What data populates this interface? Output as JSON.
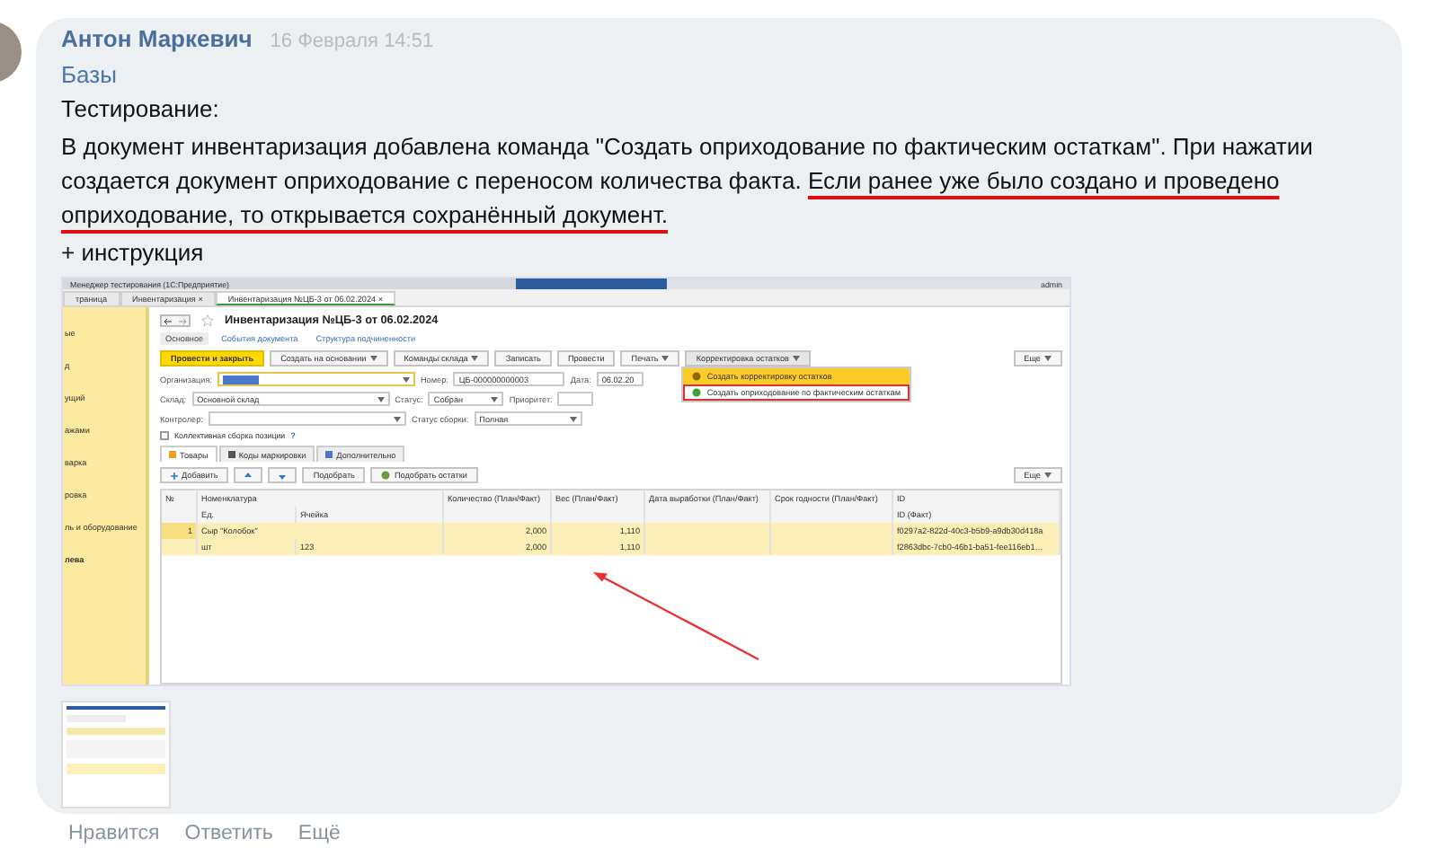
{
  "message": {
    "author": "Антон Маркевич",
    "time": "16 Февраля 14:51",
    "link": "Базы",
    "heading": "Тестирование:",
    "body": "В документ инвентаризация добавлена команда \"Создать оприходование по фактическим остаткам\". При нажатии создается документ оприходование с переносом количества факта. ",
    "highlight": "Если ранее уже было создано и проведено оприходование, то открывается сохранённый документ.",
    "extra": "+ инструкция"
  },
  "attachment": {
    "window_title": "Менеджер тестирования (1С:Предприятие)",
    "user": "admin",
    "tabs": [
      {
        "label": "траница",
        "selected": false
      },
      {
        "label": "Инвентаризация",
        "close": "×",
        "selected": false
      },
      {
        "label": "Инвентаризация №ЦБ-3 от 06.02.2024",
        "close": "×",
        "selected": true
      }
    ],
    "sidebar": [
      {
        "label": "ые",
        "selected": false
      },
      {
        "label": "д",
        "selected": false
      },
      {
        "label": "ущий",
        "selected": false
      },
      {
        "label": "ажами",
        "selected": false
      },
      {
        "label": "варка",
        "selected": false
      },
      {
        "label": "ровка",
        "selected": false
      },
      {
        "label": "ль и оборудование",
        "selected": false
      },
      {
        "label": "лева",
        "selected": true
      }
    ],
    "document_title": "Инвентаризация №ЦБ-3 от 06.02.2024",
    "links": [
      {
        "label": "Основное",
        "selected": true
      },
      {
        "label": "События документа",
        "selected": false
      },
      {
        "label": "Структура подчиненности",
        "selected": false
      }
    ],
    "toolbar": [
      {
        "label": "Провести и закрыть",
        "kind": "primary"
      },
      {
        "label": "Создать на основании",
        "kind": "menu"
      },
      {
        "label": "Команды склада",
        "kind": "menu"
      },
      {
        "label": "Записать",
        "kind": "plain"
      },
      {
        "label": "Провести",
        "kind": "plain"
      },
      {
        "label": "Печать",
        "kind": "menu"
      },
      {
        "label": "Корректировка остатков",
        "kind": "dropdown"
      },
      {
        "label": "Еще",
        "kind": "more"
      }
    ],
    "dropdown": [
      {
        "label": "Создать корректировку остатков",
        "selected": true,
        "outlined": false
      },
      {
        "label": "Создать оприходование по фактическим остаткам",
        "selected": false,
        "outlined": true
      }
    ],
    "form": [
      [
        {
          "label": "Организация:",
          "kind": "select",
          "focused": true
        },
        {
          "label": "Номер:",
          "value": "ЦБ-000000000003",
          "kind": "text",
          "focused": false
        },
        {
          "label": "Дата:",
          "value": "06.02.20",
          "kind": "text",
          "focused": false
        }
      ],
      [
        {
          "label": "Склад:",
          "value": "Основной склад",
          "kind": "select",
          "focused": false
        },
        {
          "label": "Статус:",
          "value": "Собран",
          "kind": "select",
          "focused": false
        },
        {
          "label": "Приоритет:",
          "kind": "text",
          "focused": false
        }
      ],
      [
        {
          "label": "Контролер:",
          "kind": "select",
          "focused": false
        },
        {
          "label": "Статус сборки:",
          "value": "Полная",
          "kind": "select",
          "focused": false
        }
      ]
    ],
    "checkbox": {
      "label": "Коллективная сборка позиции",
      "help": "?",
      "checked": false
    },
    "sections": [
      {
        "label": "Товары",
        "selected": true
      },
      {
        "label": "Коды маркировки",
        "selected": false
      },
      {
        "label": "Дополнительно",
        "selected": false
      }
    ],
    "table_toolbar": [
      {
        "label": "Добавить",
        "kind": "add"
      },
      {
        "kind": "up"
      },
      {
        "kind": "down"
      },
      {
        "label": "Подобрать",
        "kind": "plain"
      },
      {
        "label": "Подобрать остатки",
        "kind": "pick"
      },
      {
        "label": "Еще",
        "kind": "more"
      }
    ],
    "rows": [
      {
        "kind": "header",
        "no": "№",
        "item": "Номенклатура",
        "qty": "Количество (План/Факт)",
        "weight": "Вес (План/Факт)",
        "made": "Дата выработки (План/Факт)",
        "expires": "Срок годности (План/Факт)",
        "id": "ID"
      },
      {
        "kind": "header",
        "unit": "Ед.",
        "bin": "Ячейка",
        "id": "ID (Факт)"
      },
      {
        "kind": "data",
        "no": "1",
        "item": "Сыр \"Колобок\"",
        "qty": "2,000",
        "weight": "1,110",
        "id": "f0297a2-822d-40c3-b5b9-a9db30d418a"
      },
      {
        "kind": "data",
        "unit": "шт",
        "bin": "123",
        "qty": "2,000",
        "weight": "1,110",
        "id": "f2863dbc-7cb0-46b1-ba51-fee116eb1…"
      }
    ]
  },
  "actions": [
    "Нравится",
    "Ответить",
    "Ещё"
  ]
}
